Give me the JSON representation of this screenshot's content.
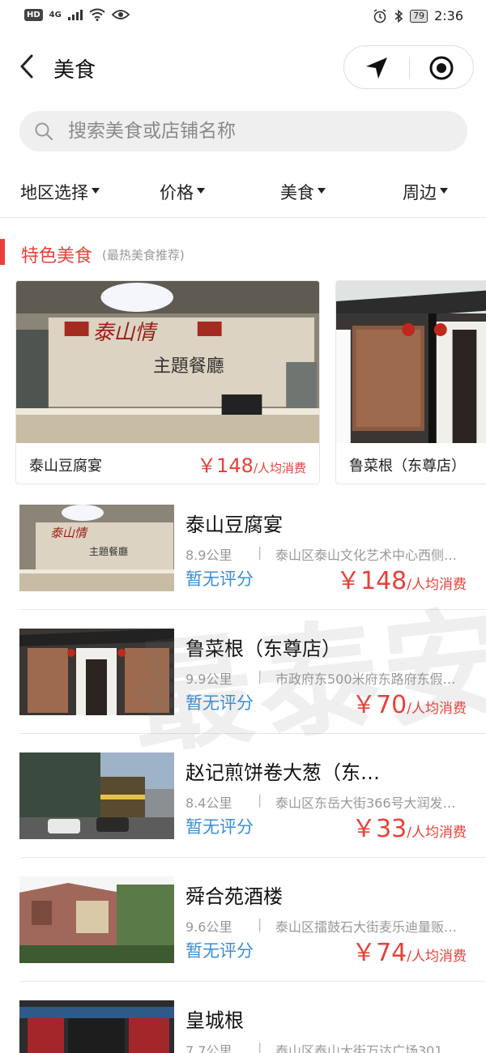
{
  "status_bar": {
    "hd": "HD",
    "network": "4G",
    "battery": "79",
    "time": "2:36"
  },
  "nav": {
    "title": "美食"
  },
  "search": {
    "placeholder": "搜索美食或店铺名称"
  },
  "filters": [
    {
      "label": "地区选择"
    },
    {
      "label": "价格"
    },
    {
      "label": "美食"
    },
    {
      "label": "周边"
    }
  ],
  "section": {
    "title": "特色美食",
    "subtitle": "(最热美食推荐)"
  },
  "featured": [
    {
      "name": "泰山豆腐宴",
      "price": "￥148",
      "unit": "/人均消费",
      "sign_text": "泰山情 主題餐廳"
    },
    {
      "name": "鲁菜根（东尊店）",
      "price": "",
      "unit": ""
    }
  ],
  "list": [
    {
      "name": "泰山豆腐宴",
      "distance": "8.9公里",
      "separator": "|",
      "address": "泰山区泰山文化艺术中心西侧…",
      "rating": "暂无评分",
      "price": "￥148",
      "unit": "/人均消费"
    },
    {
      "name": "鲁菜根（东尊店）",
      "distance": "9.9公里",
      "separator": "|",
      "address": "市政府东500米府东路府东假…",
      "rating": "暂无评分",
      "price": "￥70",
      "unit": "/人均消费"
    },
    {
      "name": "赵记煎饼卷大葱（东…",
      "distance": "8.4公里",
      "separator": "|",
      "address": "泰山区东岳大街366号大润发…",
      "rating": "暂无评分",
      "price": "￥33",
      "unit": "/人均消费"
    },
    {
      "name": "舜合苑酒楼",
      "distance": "9.6公里",
      "separator": "|",
      "address": "泰山区擂鼓石大街麦乐迪量贩…",
      "rating": "暂无评分",
      "price": "￥74",
      "unit": "/人均消费"
    },
    {
      "name": "皇城根",
      "distance": "7.7公里",
      "separator": "|",
      "address": "泰山区泰山大街万达广场301…",
      "rating": "",
      "price": "",
      "unit": ""
    }
  ],
  "watermark": "最泰安",
  "colors": {
    "accent_red": "#e8413b",
    "rating_blue": "#3a8fd6",
    "search_bg": "#efefef"
  },
  "icons": [
    "back-icon",
    "location-arrow-icon",
    "target-icon",
    "search-icon",
    "caret-down-icon",
    "alarm-icon",
    "bluetooth-icon",
    "wifi-icon",
    "eye-icon"
  ]
}
